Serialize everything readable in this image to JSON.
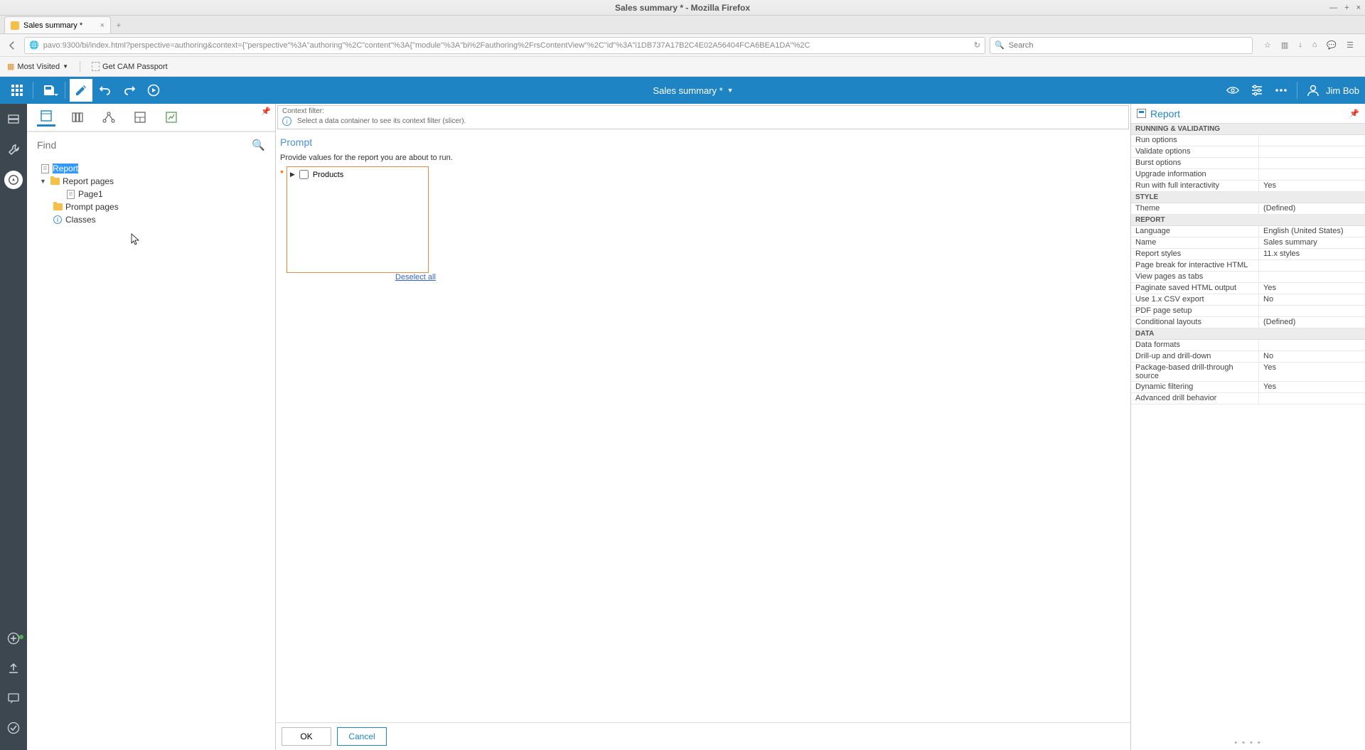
{
  "os": {
    "title": "Sales summary * - Mozilla Firefox"
  },
  "browser": {
    "tab_title": "Sales summary *",
    "url": "pavo:9300/bi/index.html?perspective=authoring&context={\"perspective\"%3A\"authoring\"%2C\"content\"%3A{\"module\"%3A\"bi%2Fauthoring%2FrsContentView\"%2C\"id\"%3A\"i1DB737A17B2C4E02A56404FCA6BEA1DA\"%2C",
    "search_placeholder": "Search",
    "bookmarks": {
      "most_visited": "Most Visited",
      "get_cam": "Get CAM Passport"
    }
  },
  "toolbar": {
    "doc_title": "Sales summary *",
    "user_name": "Jim Bob"
  },
  "left_panel": {
    "find_placeholder": "Find",
    "tree": {
      "report": "Report",
      "report_pages": "Report pages",
      "page1": "Page1",
      "prompt_pages": "Prompt pages",
      "classes": "Classes"
    }
  },
  "canvas": {
    "context_filter_label": "Context filter:",
    "context_filter_hint": "Select a data container to see its context filter (slicer).",
    "prompt_title": "Prompt",
    "prompt_desc": "Provide values for the report you are about to run.",
    "products": "Products",
    "deselect": "Deselect all",
    "ok": "OK",
    "cancel": "Cancel"
  },
  "props": {
    "panel_title": "Report",
    "sections": {
      "running": {
        "header": "RUNNING & VALIDATING",
        "rows": [
          {
            "l": "Run options",
            "v": ""
          },
          {
            "l": "Validate options",
            "v": ""
          },
          {
            "l": "Burst options",
            "v": ""
          },
          {
            "l": "Upgrade information",
            "v": ""
          },
          {
            "l": "Run with full interactivity",
            "v": "Yes"
          }
        ]
      },
      "style": {
        "header": "STYLE",
        "rows": [
          {
            "l": "Theme",
            "v": "(Defined)"
          }
        ]
      },
      "report": {
        "header": "REPORT",
        "rows": [
          {
            "l": "Language",
            "v": "English (United States)"
          },
          {
            "l": "Name",
            "v": "Sales summary"
          },
          {
            "l": "Report styles",
            "v": "11.x styles"
          },
          {
            "l": "Page break for interactive HTML",
            "v": ""
          },
          {
            "l": "View pages as tabs",
            "v": ""
          },
          {
            "l": "Paginate saved HTML output",
            "v": "Yes"
          },
          {
            "l": "Use 1.x CSV export",
            "v": "No"
          },
          {
            "l": "PDF page setup",
            "v": ""
          },
          {
            "l": "Conditional layouts",
            "v": "(Defined)"
          }
        ]
      },
      "data": {
        "header": "DATA",
        "rows": [
          {
            "l": "Data formats",
            "v": ""
          },
          {
            "l": "Drill-up and drill-down",
            "v": "No"
          },
          {
            "l": "Package-based drill-through source",
            "v": "Yes"
          },
          {
            "l": "Dynamic filtering",
            "v": "Yes"
          },
          {
            "l": "Advanced drill behavior",
            "v": ""
          }
        ]
      }
    }
  }
}
